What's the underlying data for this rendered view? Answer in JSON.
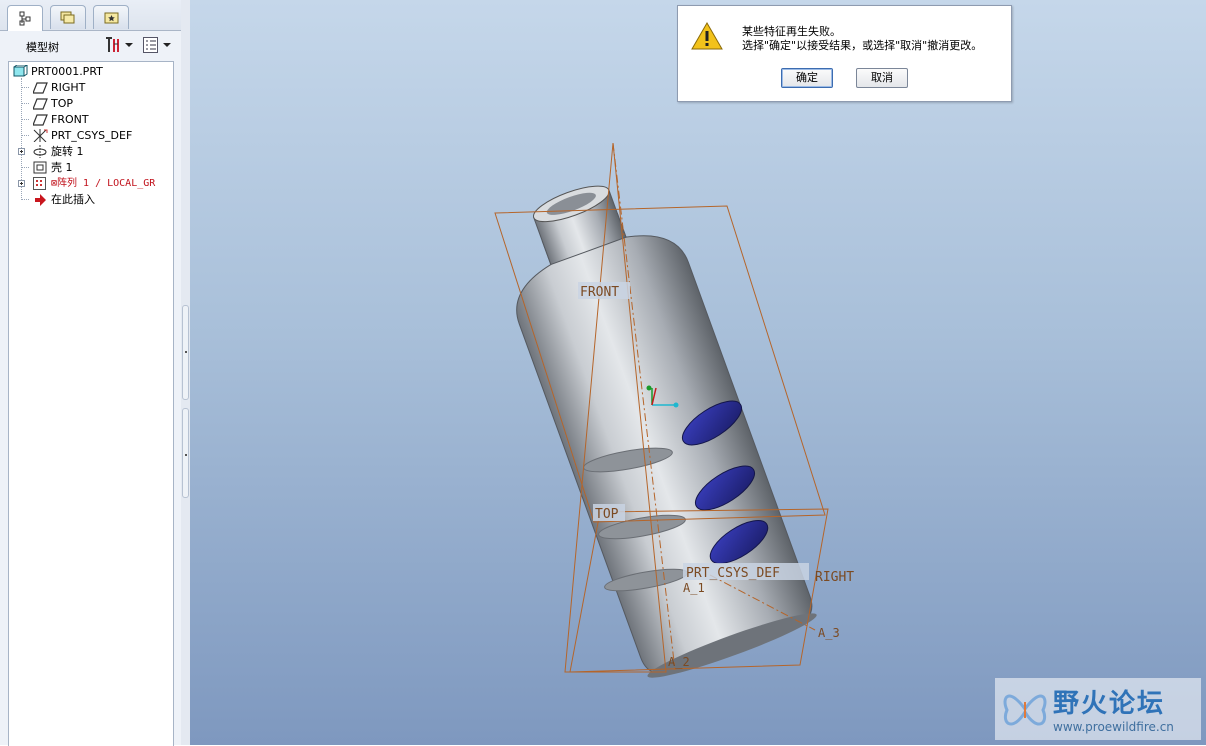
{
  "model_tree": {
    "title": "模型树",
    "items": [
      {
        "label": "PRT0001.PRT"
      },
      {
        "label": "RIGHT"
      },
      {
        "label": "TOP"
      },
      {
        "label": "FRONT"
      },
      {
        "label": "PRT_CSYS_DEF"
      },
      {
        "label": "旋转 1"
      },
      {
        "label": "壳 1"
      },
      {
        "label": "⊠阵列 1 / LOCAL_GR"
      },
      {
        "label": "在此插入"
      }
    ]
  },
  "dialog": {
    "line1": "某些特征再生失败。",
    "line2": "选择\"确定\"以接受结果，或选择\"取消\"撤消更改。",
    "ok_label": "确定",
    "cancel_label": "取消"
  },
  "viewport": {
    "datum_labels": {
      "front": "FRONT",
      "top": "TOP",
      "right": "RIGHT",
      "csys": "PRT_CSYS_DEF",
      "axis_1": "A_1",
      "axis_2": "A_2",
      "axis_3": "A_3"
    }
  },
  "watermark": {
    "cn": "野火论坛",
    "url": "www.proewildfire.cn"
  },
  "colors": {
    "datum": "#b5652a",
    "cut_blue": "#2a2d8f",
    "error_red": "#c1121c",
    "accent_blue": "#2f73b8"
  }
}
